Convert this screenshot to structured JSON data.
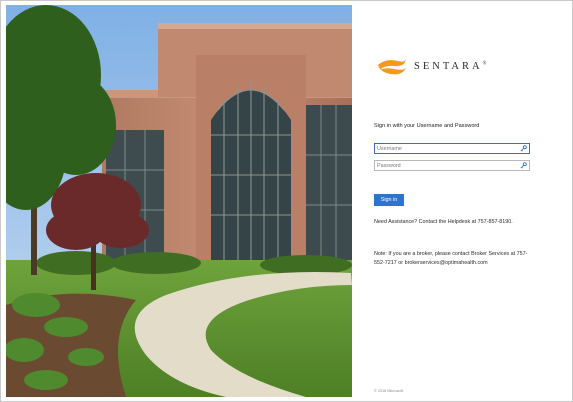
{
  "brand": {
    "name": "SENTARA",
    "mark": "®"
  },
  "login": {
    "instruction": "Sign in with your Username and Password",
    "username_placeholder": "Username",
    "password_placeholder": "Password",
    "signin_label": "Sign in",
    "assistance": "Need Assistance? Contact the Helpdesk at 757-857-8190.",
    "broker_note": "Note: If you are a broker, please contact Broker Services at 757-552-7217 or brokerservices@optimahealth.com"
  },
  "footer": {
    "copyright": "© 2016 Microsoft"
  },
  "colors": {
    "accent": "#2b74cf",
    "focus": "#3d6fb8",
    "logo_orange": "#f39a1e"
  }
}
